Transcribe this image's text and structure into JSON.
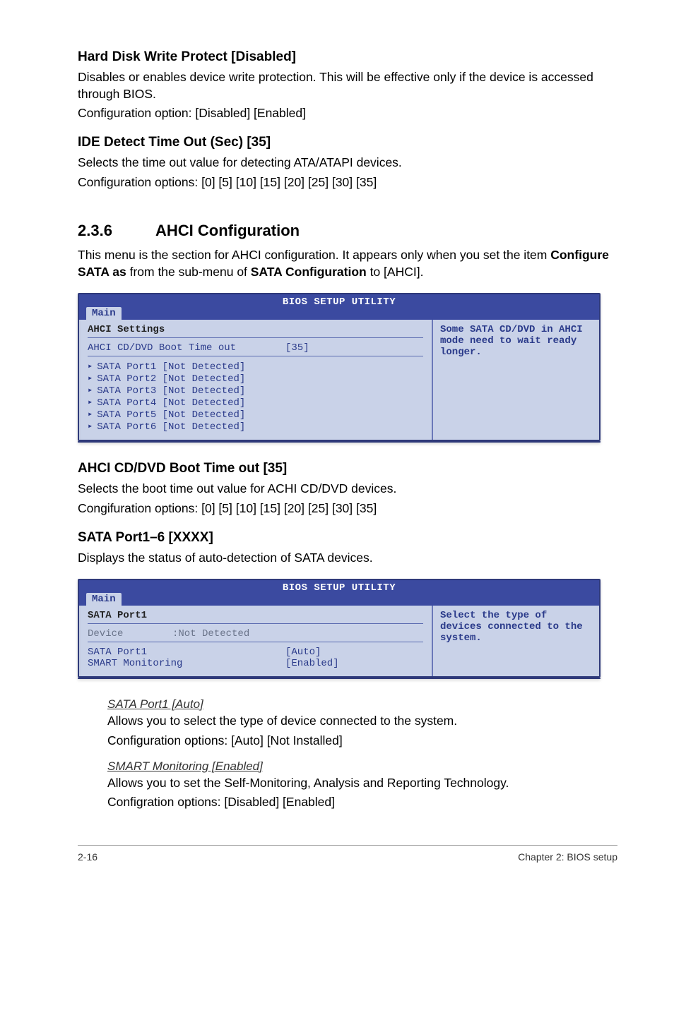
{
  "section1": {
    "h": "Hard Disk Write Protect [Disabled]",
    "p1": "Disables or enables device write protection. This will be effective only if the device is accessed through BIOS.",
    "p2": "Configuration option: [Disabled] [Enabled]"
  },
  "section2": {
    "h": "IDE Detect Time Out (Sec) [35]",
    "p1": "Selects the time out value for detecting ATA/ATAPI devices.",
    "p2": "Configuration options: [0] [5] [10] [15] [20] [25] [30] [35]"
  },
  "ahci": {
    "num": "2.3.6",
    "title": "AHCI Configuration",
    "intro_a": "This menu is the section for AHCI configuration. It appears only when you set the item ",
    "intro_b": "Configure SATA as",
    "intro_c": " from the sub-menu of ",
    "intro_d": "SATA Configuration",
    "intro_e": " to [AHCI]."
  },
  "bios1": {
    "title": "BIOS SETUP UTILITY",
    "tab": "Main",
    "heading": "AHCI Settings",
    "opt_k": "AHCI CD/DVD Boot Time out",
    "opt_v": "[35]",
    "ports": [
      "SATA Port1 [Not Detected]",
      "SATA Port2 [Not Detected]",
      "SATA Port3 [Not Detected]",
      "SATA Port4 [Not Detected]",
      "SATA Port5 [Not Detected]",
      "SATA Port6 [Not Detected]"
    ],
    "help": "Some SATA CD/DVD in AHCI mode need to wait ready longer."
  },
  "section3": {
    "h": "AHCI CD/DVD Boot Time out [35]",
    "p1": "Selects the boot time out value for ACHI CD/DVD devices.",
    "p2": "Congifuration options: [0] [5] [10] [15] [20] [25] [30] [35]"
  },
  "section4": {
    "h": "SATA Port1–6 [XXXX]",
    "p1": "Displays the status of auto-detection of SATA devices."
  },
  "bios2": {
    "title": "BIOS SETUP UTILITY",
    "tab": "Main",
    "heading": "SATA Port1",
    "dev_k": "Device",
    "dev_v": ":Not Detected",
    "r1k": "SATA Port1",
    "r1v": "[Auto]",
    "r2k": "SMART Monitoring",
    "r2v": "[Enabled]",
    "help": "Select the type of devices connected to the system."
  },
  "sub1": {
    "h": "SATA Port1 [Auto]",
    "p1": "Allows you to select the type of device connected to the system.",
    "p2": "Configuration options: [Auto] [Not Installed]"
  },
  "sub2": {
    "h": "SMART Monitoring [Enabled]",
    "p1": "Allows you to set the Self-Monitoring, Analysis and Reporting Technology.",
    "p2": "Configration options: [Disabled] [Enabled]"
  },
  "footer": {
    "left": "2-16",
    "right": "Chapter 2: BIOS setup"
  },
  "chart_data": {
    "type": "table",
    "panels": [
      {
        "title": "AHCI Settings",
        "rows": [
          {
            "key": "AHCI CD/DVD Boot Time out",
            "value": "[35]"
          },
          {
            "key": "SATA Port1",
            "value": "[Not Detected]"
          },
          {
            "key": "SATA Port2",
            "value": "[Not Detected]"
          },
          {
            "key": "SATA Port3",
            "value": "[Not Detected]"
          },
          {
            "key": "SATA Port4",
            "value": "[Not Detected]"
          },
          {
            "key": "SATA Port5",
            "value": "[Not Detected]"
          },
          {
            "key": "SATA Port6",
            "value": "[Not Detected]"
          }
        ],
        "help": "Some SATA CD/DVD in AHCI mode need to wait ready longer."
      },
      {
        "title": "SATA Port1",
        "rows": [
          {
            "key": "Device",
            "value": ":Not Detected"
          },
          {
            "key": "SATA Port1",
            "value": "[Auto]"
          },
          {
            "key": "SMART Monitoring",
            "value": "[Enabled]"
          }
        ],
        "help": "Select the type of devices connected to the system."
      }
    ]
  }
}
